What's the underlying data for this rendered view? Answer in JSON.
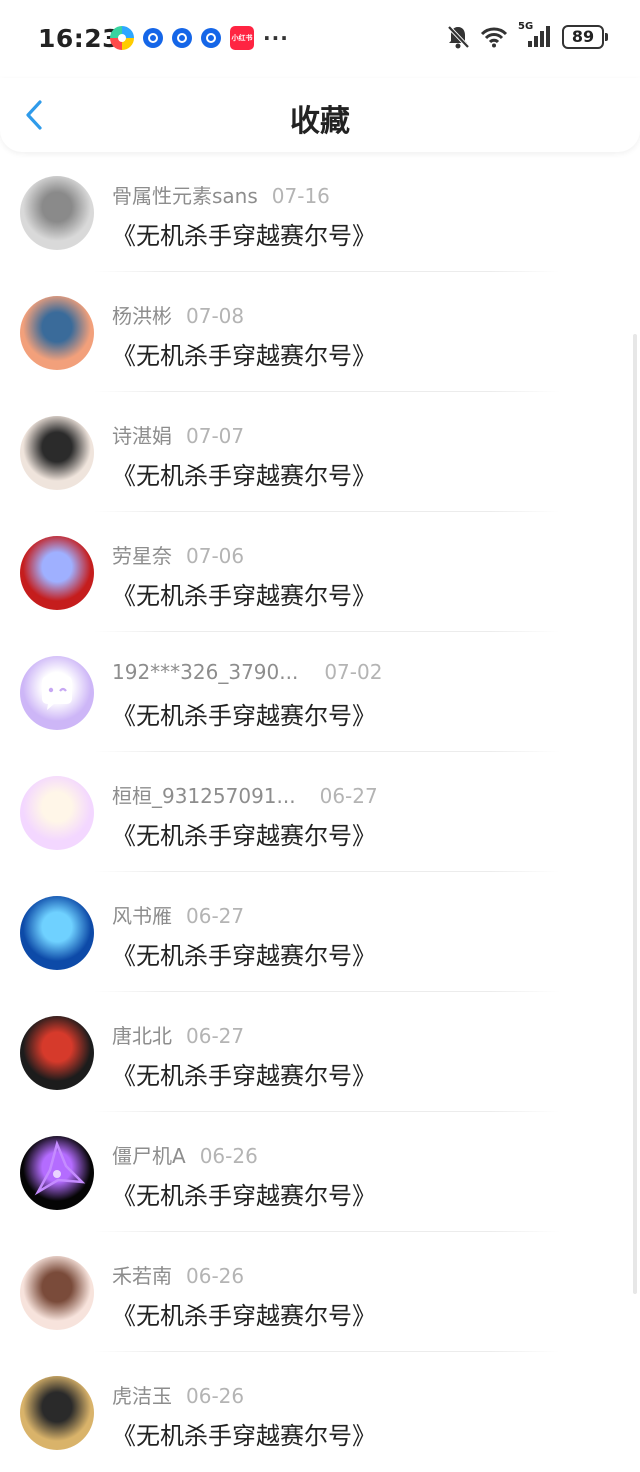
{
  "status_bar": {
    "time": "16:23",
    "app_badge": "小红书",
    "more": "···",
    "battery": "89",
    "network": "5G"
  },
  "header": {
    "title": "收藏"
  },
  "items": [
    {
      "user": "骨属性元素sans",
      "date": "07-16",
      "title": "《无机杀手穿越赛尔号》",
      "avatar_colors": [
        "#d9d9d9",
        "#8a8a8a"
      ]
    },
    {
      "user": "杨洪彬",
      "date": "07-08",
      "title": "《无机杀手穿越赛尔号》",
      "avatar_colors": [
        "#f2a07b",
        "#3a6b9a"
      ]
    },
    {
      "user": "诗湛娟",
      "date": "07-07",
      "title": "《无机杀手穿越赛尔号》",
      "avatar_colors": [
        "#efe4dc",
        "#2b2b2b"
      ]
    },
    {
      "user": "劳星奈",
      "date": "07-06",
      "title": "《无机杀手穿越赛尔号》",
      "avatar_colors": [
        "#c51d1d",
        "#9fb0ff"
      ]
    },
    {
      "user": "192***326_3790...",
      "date": "07-02",
      "title": "《无机杀手穿越赛尔号》",
      "avatar_colors": [
        "#cdb6f7",
        "#ffffff"
      ]
    },
    {
      "user": "桓桓_931257091...",
      "date": "06-27",
      "title": "《无机杀手穿越赛尔号》",
      "avatar_colors": [
        "#f3d7ff",
        "#fff6e8"
      ]
    },
    {
      "user": "风书雁",
      "date": "06-27",
      "title": "《无机杀手穿越赛尔号》",
      "avatar_colors": [
        "#0d4aa8",
        "#6fd1ff"
      ]
    },
    {
      "user": "唐北北",
      "date": "06-27",
      "title": "《无机杀手穿越赛尔号》",
      "avatar_colors": [
        "#1c1c1c",
        "#d63a2b"
      ]
    },
    {
      "user": "僵尸机A",
      "date": "06-26",
      "title": "《无机杀手穿越赛尔号》",
      "avatar_colors": [
        "#050505",
        "#b46cff"
      ]
    },
    {
      "user": "禾若南",
      "date": "06-26",
      "title": "《无机杀手穿越赛尔号》",
      "avatar_colors": [
        "#f7e3dc",
        "#7a4b3a"
      ]
    },
    {
      "user": "虎洁玉",
      "date": "06-26",
      "title": "《无机杀手穿越赛尔号》",
      "avatar_colors": [
        "#d9b36a",
        "#2a2a2a"
      ]
    }
  ]
}
